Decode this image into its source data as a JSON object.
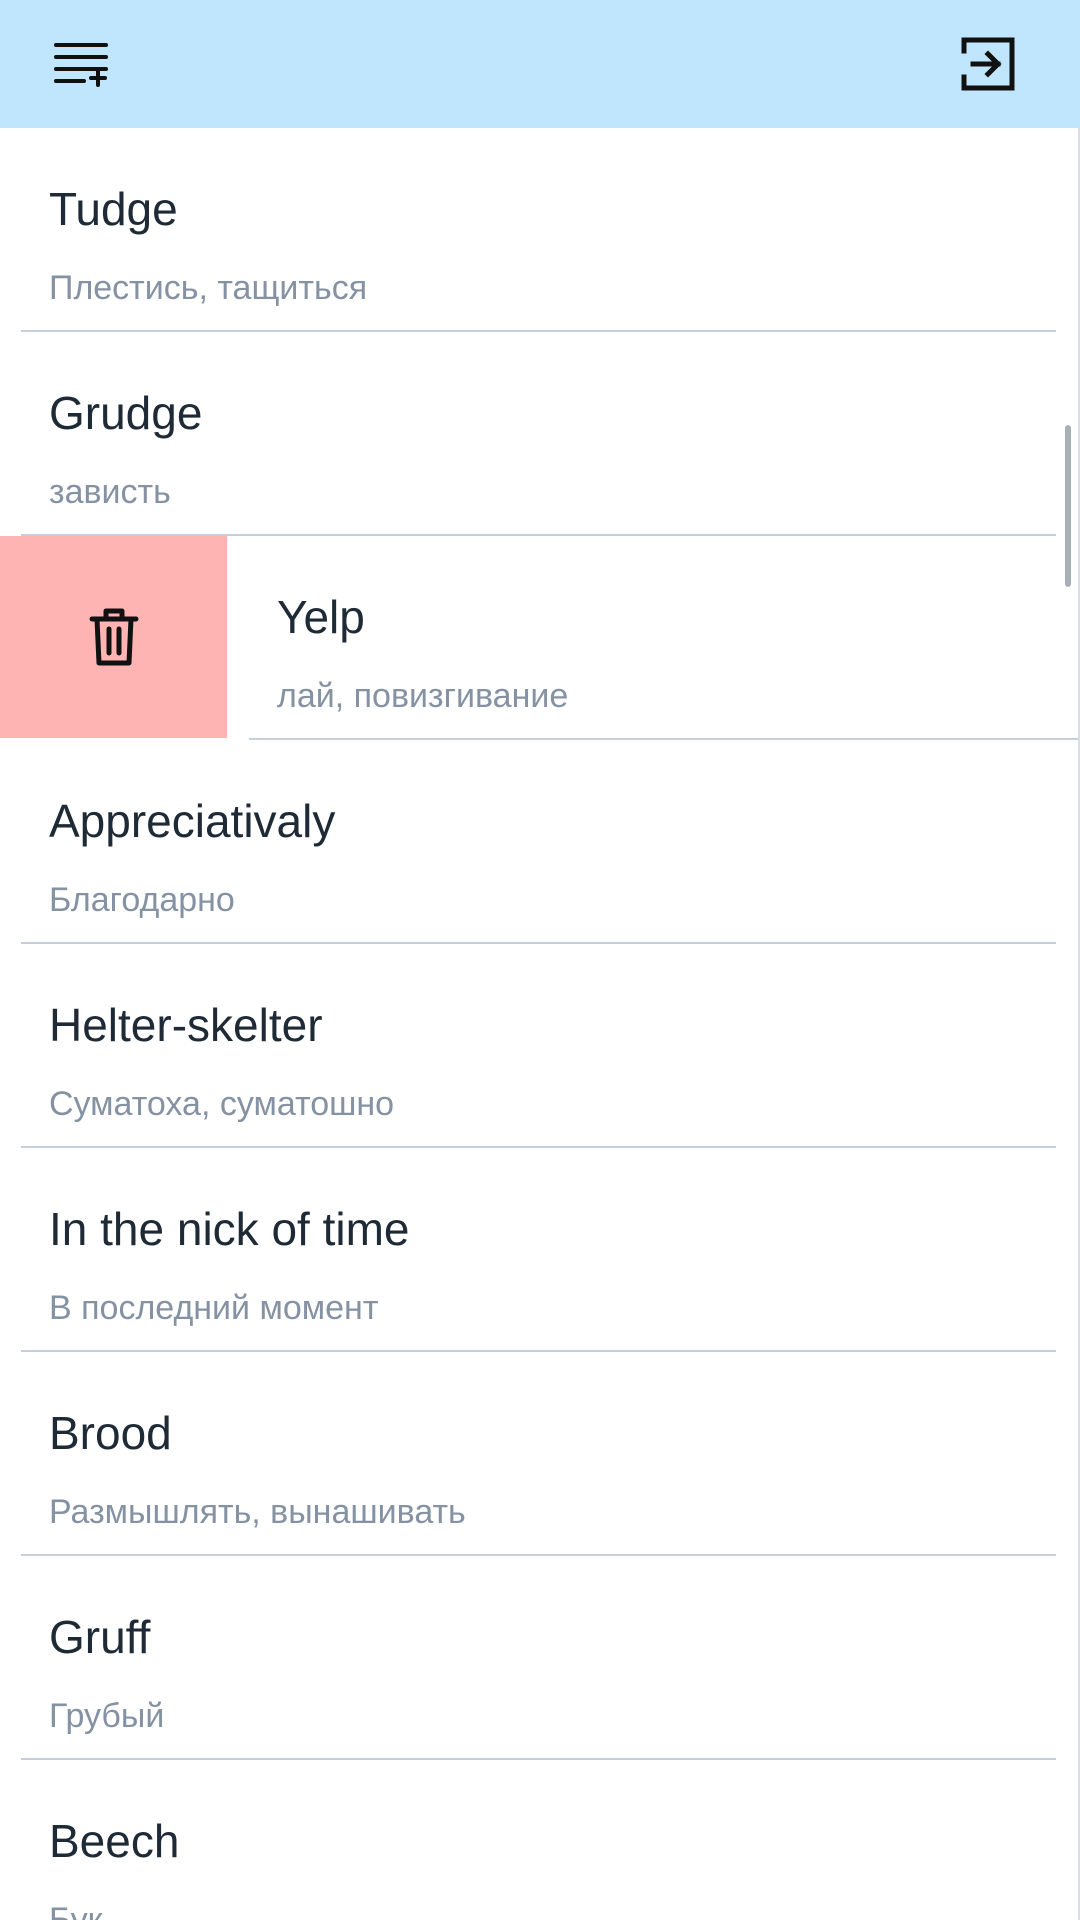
{
  "header": {
    "background": "#bfe6fd",
    "left_icon": "playlist-add-icon",
    "right_icon": "login-exit-icon"
  },
  "colors": {
    "word_text": "#1f2a37",
    "translation_text": "#8592a3",
    "divider": "#c5cedb",
    "delete_action": "#ffb4b4"
  },
  "swiped_row": {
    "index": 2,
    "action_icon": "trash-icon"
  },
  "words": [
    {
      "word": "Tudge",
      "translation": "Плестись, тащиться"
    },
    {
      "word": "Grudge",
      "translation": "зависть"
    },
    {
      "word": "Yelp",
      "translation": "лай, повизгивание"
    },
    {
      "word": "Appreciativaly",
      "translation": "Благодарно"
    },
    {
      "word": "Helter-skelter",
      "translation": "Суматоха, суматошно"
    },
    {
      "word": "In the nick of time",
      "translation": "В последний момент"
    },
    {
      "word": "Brood",
      "translation": "Размышлять, вынашивать"
    },
    {
      "word": "Gruff",
      "translation": "Грубый"
    },
    {
      "word": "Beech",
      "translation": "Бук"
    }
  ]
}
